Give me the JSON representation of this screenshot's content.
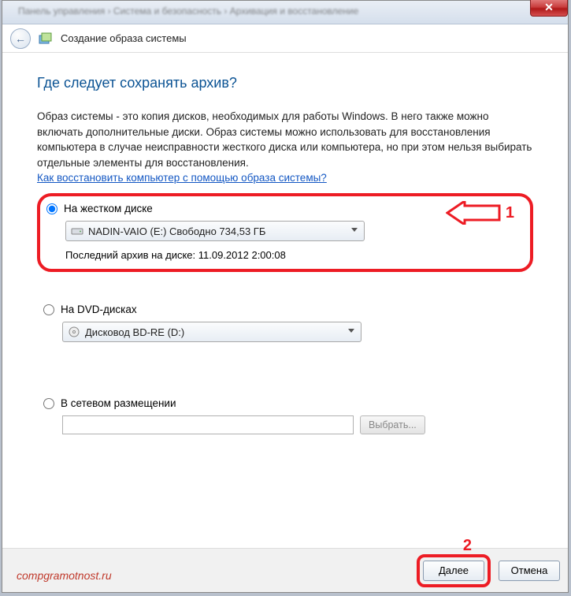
{
  "titlebar": {
    "breadcrumb": "Панель управления  ›  Система и безопасность  ›  Архивация и восстановление"
  },
  "header": {
    "title": "Создание образа системы"
  },
  "main": {
    "question": "Где следует сохранять архив?",
    "description": "Образ системы - это копия дисков, необходимых для работы Windows. В него также можно включать дополнительные диски. Образ системы можно использовать для восстановления компьютера в случае неисправности жесткого диска или компьютера, но при этом нельзя выбирать отдельные элементы для восстановления.",
    "helplink": "Как восстановить компьютер с помощью образа системы?"
  },
  "options": {
    "hdd": {
      "label": "На жестком диске",
      "combo": "NADIN-VAIO (E:)  Свободно 734,53 ГБ",
      "last": "Последний архив на диске: 11.09.2012 2:00:08"
    },
    "dvd": {
      "label": "На DVD-дисках",
      "combo": "Дисковод BD-RE (D:)"
    },
    "network": {
      "label": "В сетевом размещении",
      "input_value": "",
      "browse": "Выбрать..."
    }
  },
  "annotations": {
    "arrow1": "1",
    "arrow2": "2"
  },
  "footer": {
    "watermark": "compgramotnost.ru",
    "next": "Далее",
    "cancel": "Отмена"
  }
}
